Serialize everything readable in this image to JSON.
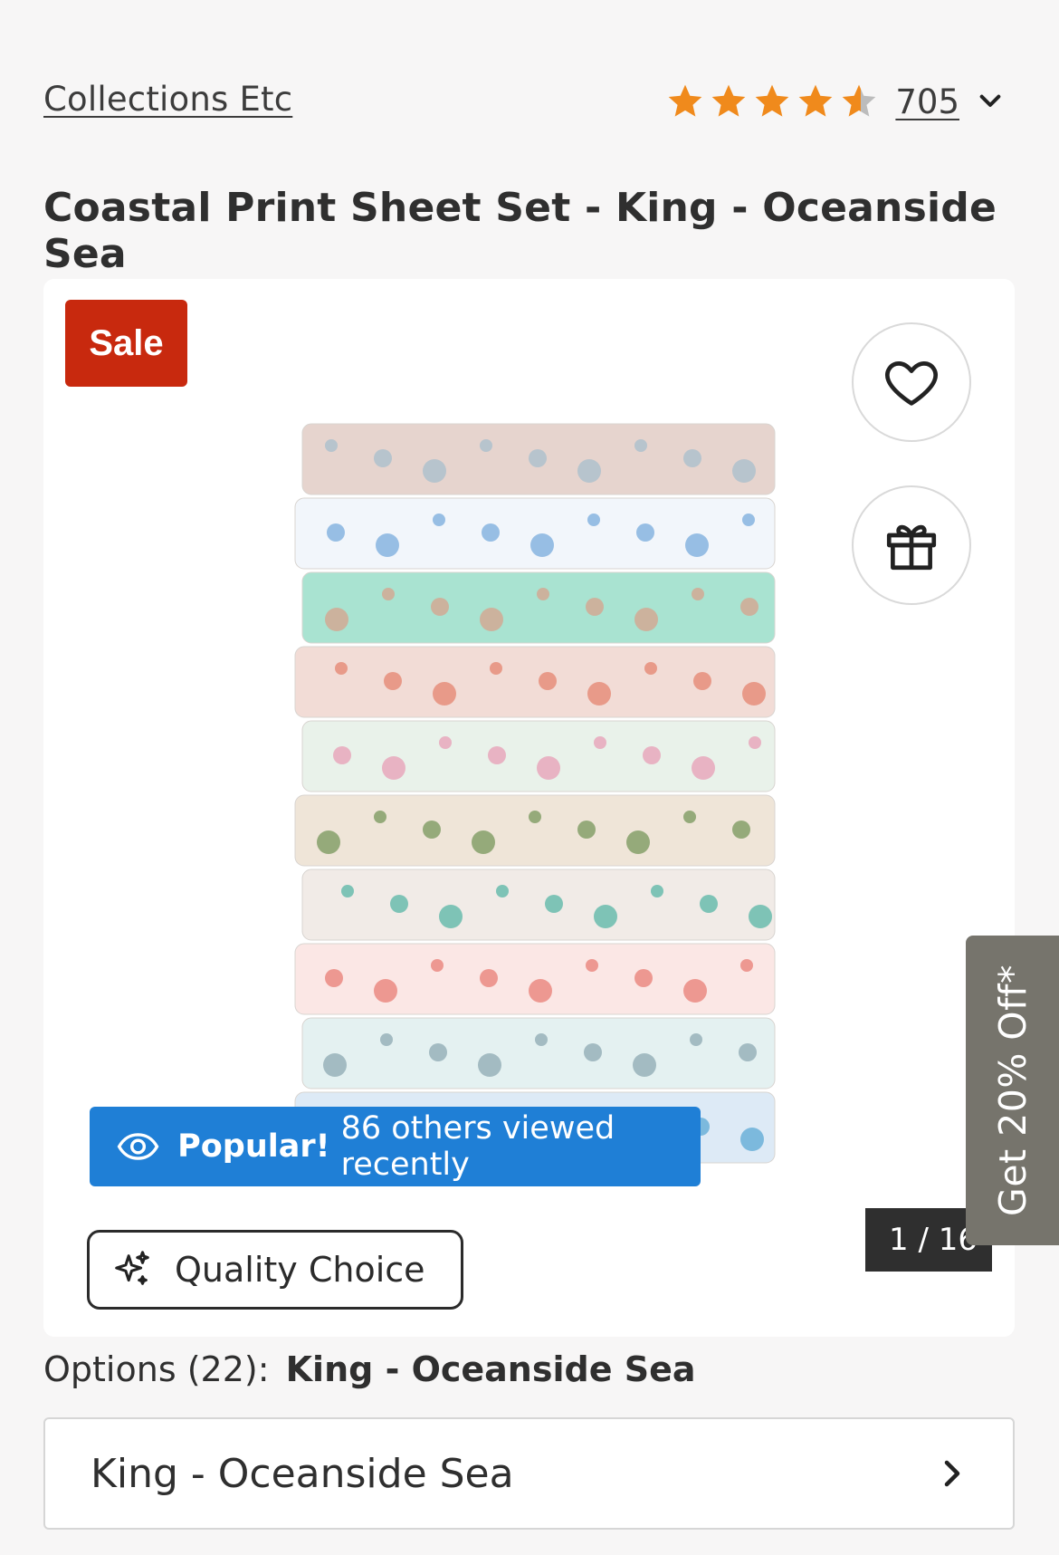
{
  "brand": {
    "name": "Collections Etc"
  },
  "rating": {
    "stars": 4.5,
    "max_stars": 5,
    "review_count": "705",
    "star_color": "#f08a1c",
    "star_empty_color": "#bcbcbc"
  },
  "product": {
    "title": "Coastal Print Sheet Set - King - Oceanside Sea"
  },
  "gallery": {
    "sale_badge": "Sale",
    "counter": "1 / 16",
    "popular_strong": "Popular!",
    "popular_text": "86 others viewed recently",
    "quality_badge": "Quality Choice",
    "sheet_colors": [
      "#e6d4ce",
      "#f2f6fb",
      "#a9e3d1",
      "#f2dcd6",
      "#e9f2ea",
      "#efe5d8",
      "#f1ebe7",
      "#fbe7e5",
      "#e4f1f1",
      "#ddeaf6"
    ]
  },
  "promo": {
    "label": "Get 20% Off*"
  },
  "options": {
    "label_prefix": "Options (22):",
    "selected": "King - Oceanside Sea",
    "select_value": "King - Oceanside Sea"
  },
  "colors": {
    "sale": "#c8290e",
    "popular": "#1f7fd6",
    "promo": "#76746c"
  }
}
